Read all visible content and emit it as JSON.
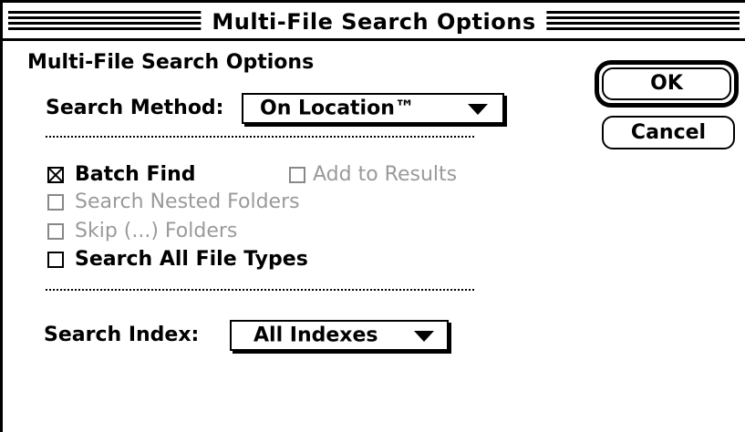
{
  "window": {
    "title": "Multi-File Search Options"
  },
  "dialog": {
    "heading": "Multi-File Search Options"
  },
  "search_method": {
    "label": "Search Method:",
    "selected": "On Location™"
  },
  "options": [
    {
      "label": "Batch Find",
      "checked": true,
      "enabled": true
    },
    {
      "label": "Add to Results",
      "checked": false,
      "enabled": false
    },
    {
      "label": "Search Nested Folders",
      "checked": false,
      "enabled": false
    },
    {
      "label": "Skip (...) Folders",
      "checked": false,
      "enabled": false
    },
    {
      "label": "Search All File Types",
      "checked": false,
      "enabled": true
    }
  ],
  "search_index": {
    "label": "Search Index:",
    "selected": "All Indexes"
  },
  "buttons": {
    "ok": "OK",
    "cancel": "Cancel"
  }
}
